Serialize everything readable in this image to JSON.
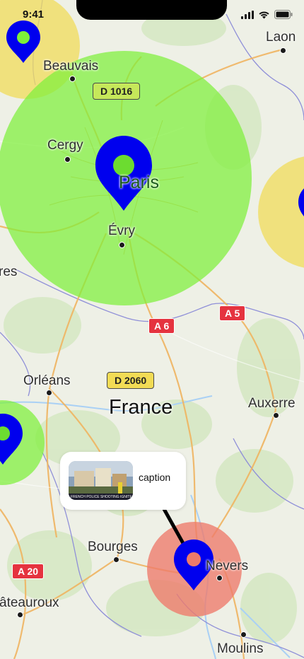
{
  "status_bar": {
    "time": "9:41"
  },
  "map": {
    "country_label": "France",
    "cities": [
      {
        "name": "Laon"
      },
      {
        "name": "Beauvais"
      },
      {
        "name": "Cergy"
      },
      {
        "name": "Paris"
      },
      {
        "name": "Évry"
      },
      {
        "name": "res"
      },
      {
        "name": "Orléans"
      },
      {
        "name": "Auxerre"
      },
      {
        "name": "Bourges"
      },
      {
        "name": "Nevers"
      },
      {
        "name": "âteauroux"
      },
      {
        "name": "Moulins"
      }
    ],
    "road_shields": [
      {
        "label": "D 1016",
        "color": "#c6e85a"
      },
      {
        "label": "D 2060",
        "color": "#f2dc55"
      },
      {
        "label": "A 6",
        "color": "#e5333f"
      },
      {
        "label": "A 5",
        "color": "#e5333f"
      },
      {
        "label": "A 20",
        "color": "#e5333f"
      }
    ],
    "zones": [
      {
        "color": "#f0dc5a"
      },
      {
        "color": "#7ef03a"
      },
      {
        "color": "#f0dc5a"
      },
      {
        "color": "#7ef03a"
      },
      {
        "color": "#ee7a6a"
      }
    ],
    "marker_color": "#0000ee",
    "callout": {
      "caption": "caption",
      "thumbnail_text": "FRENCH POLICE SHOOTING IGNITE"
    }
  }
}
